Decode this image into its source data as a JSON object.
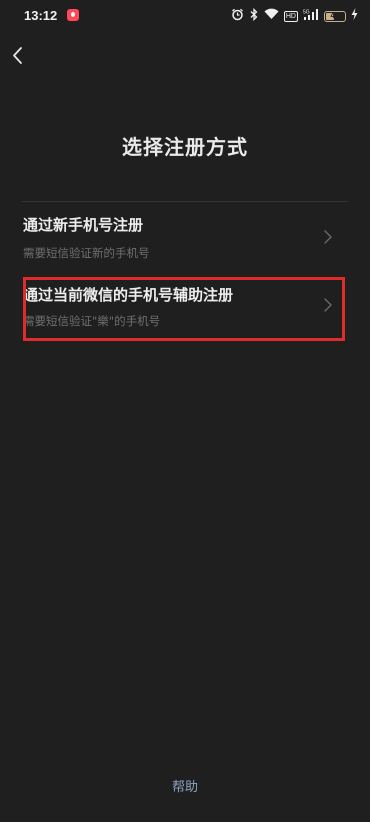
{
  "status_bar": {
    "time": "13:12",
    "battery_level": "44",
    "hd_label": "HD",
    "signal_label": "5G"
  },
  "header": {
    "title": "选择注册方式"
  },
  "options": [
    {
      "title": "通过新手机号注册",
      "subtitle": "需要短信验证新的手机号"
    },
    {
      "title": "通过当前微信的手机号辅助注册",
      "subtitle": "需要短信验证\"樂\"的手机号"
    }
  ],
  "footer": {
    "help_label": "帮助"
  },
  "colors": {
    "background": "#1f1f1f",
    "highlight": "#e02b2b",
    "help_link": "#8da2c2"
  }
}
